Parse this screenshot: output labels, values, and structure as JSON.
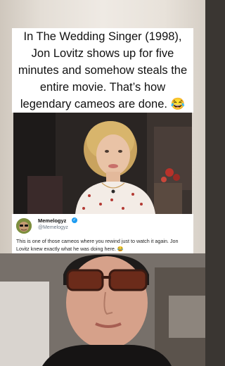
{
  "caption": {
    "text": "In The Wedding Singer (1998), Jon Lovitz shows up for five minutes and somehow steals the entire movie. That’s how legendary cameos are done. 😂"
  },
  "tweet": {
    "display_name": "Memelogyz",
    "verified_icon": "✓",
    "handle": "@Memelogyz",
    "text": "This is one of those cameos where you rewind just to watch it again. Jon Lovitz knew exactly what he was doing here. 😂"
  },
  "colors": {
    "verified": "#1d9bf0",
    "caption_bg": "#ffffff"
  }
}
